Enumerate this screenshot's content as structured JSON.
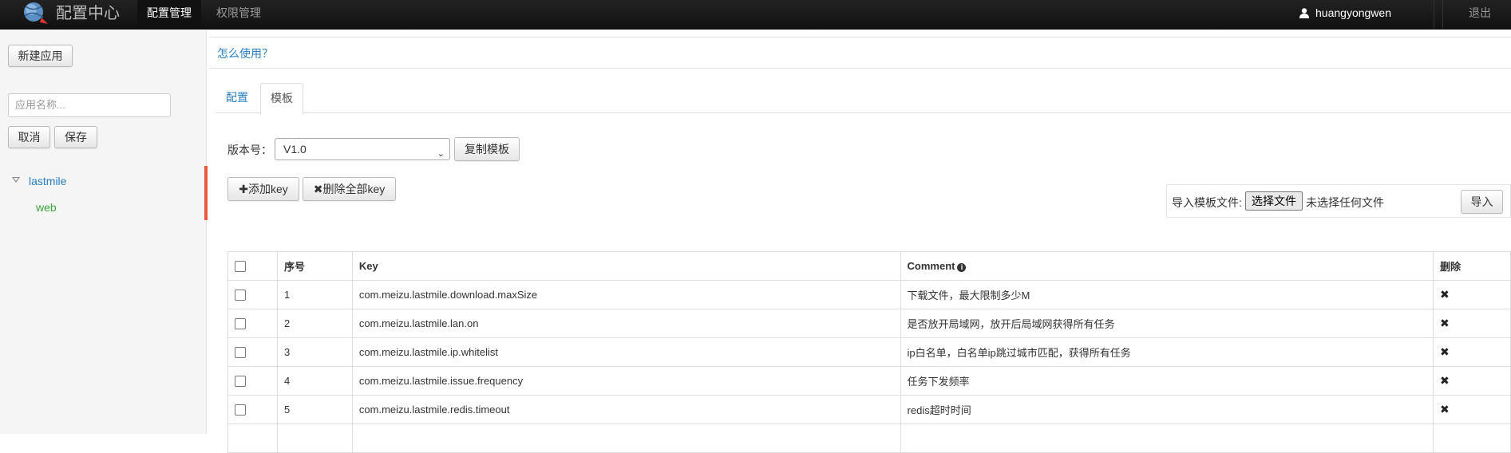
{
  "navbar": {
    "brand": "配置中心",
    "items": [
      {
        "label": "配置管理",
        "active": true
      },
      {
        "label": "权限管理",
        "active": false
      }
    ],
    "user": "huangyongwen",
    "logout": "退出"
  },
  "sidebar": {
    "new_app_label": "新建应用",
    "app_name_placeholder": "应用名称...",
    "cancel_label": "取消",
    "save_label": "保存",
    "tree": {
      "root": "lastmile",
      "children": [
        "web"
      ]
    }
  },
  "main": {
    "help_link": "怎么使用？",
    "tabs": [
      {
        "label": "配置",
        "active": false
      },
      {
        "label": "模板",
        "active": true
      }
    ],
    "version_label": "版本号：",
    "version_value": "V1.0",
    "copy_template_label": "复制模板",
    "add_key_label": "添加key",
    "delete_all_label": "删除全部key",
    "import": {
      "label": "导入模板文件:",
      "choose_file": "选择文件",
      "no_file": "未选择任何文件",
      "import_button": "导入"
    },
    "table": {
      "headers": [
        "序号",
        "Key",
        "Comment",
        "删除"
      ],
      "rows": [
        {
          "no": "1",
          "key": "com.meizu.lastmile.download.maxSize",
          "comment": "下载文件，最大限制多少M"
        },
        {
          "no": "2",
          "key": "com.meizu.lastmile.lan.on",
          "comment": "是否放开局域网，放开后局域网获得所有任务"
        },
        {
          "no": "3",
          "key": "com.meizu.lastmile.ip.whitelist",
          "comment": "ip白名单，白名单ip跳过城市匹配，获得所有任务"
        },
        {
          "no": "4",
          "key": "com.meizu.lastmile.issue.frequency",
          "comment": "任务下发频率"
        },
        {
          "no": "5",
          "key": "com.meizu.lastmile.redis.timeout",
          "comment": "redis超时时间"
        }
      ]
    }
  },
  "colors": {
    "navbar_bg": "#1b1b1b",
    "link": "#2a7ebf",
    "tree_active_accent": "#e9573f",
    "tree_child": "#3aa63a"
  }
}
